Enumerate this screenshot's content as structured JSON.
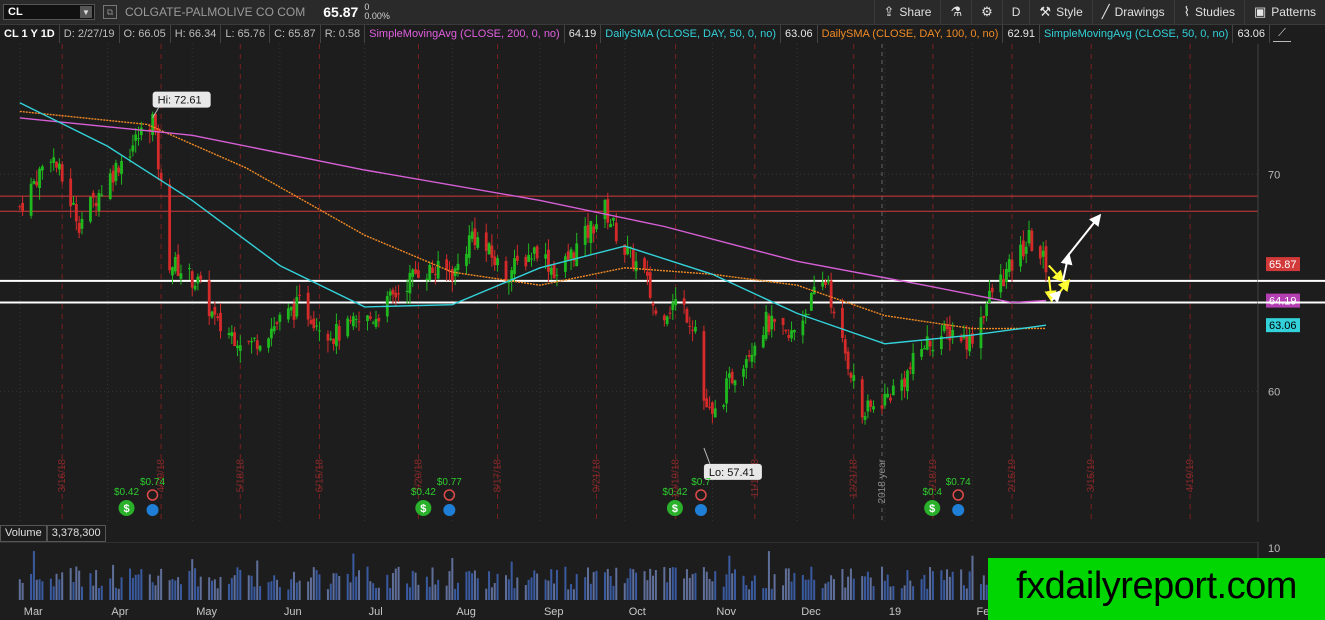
{
  "header": {
    "symbol": "CL",
    "company": "COLGATE-PALMOLIVE CO COM",
    "last": "65.87",
    "change": "0",
    "change_pct": "0.00%"
  },
  "toolbar": {
    "buttons": [
      {
        "id": "share",
        "label": "Share",
        "icon": "share-icon",
        "glyph": "⇪"
      },
      {
        "id": "flask",
        "label": "",
        "icon": "flask-icon",
        "glyph": "⚗"
      },
      {
        "id": "gear",
        "label": "",
        "icon": "gear-icon",
        "glyph": "⚙"
      },
      {
        "id": "period",
        "label": "D",
        "icon": "",
        "glyph": ""
      },
      {
        "id": "style",
        "label": "Style",
        "icon": "style-icon",
        "glyph": "⚒"
      },
      {
        "id": "drawings",
        "label": "Drawings",
        "icon": "drawings-icon",
        "glyph": "╱"
      },
      {
        "id": "studies",
        "label": "Studies",
        "icon": "studies-icon",
        "glyph": "⌇"
      },
      {
        "id": "patterns",
        "label": "Patterns",
        "icon": "patterns-icon",
        "glyph": "▣"
      }
    ]
  },
  "studies_bar": {
    "symbol_period": "CL 1 Y 1D",
    "date": "D: 2/27/19",
    "open": "O: 66.05",
    "high": "H: 66.34",
    "low": "L: 65.76",
    "close": "C: 65.87",
    "range": "R: 0.58",
    "studies": [
      {
        "label": "SimpleMovingAvg (CLOSE, 200, 0, no)",
        "value": "64.19",
        "color": "#e05fe0"
      },
      {
        "label": "DailySMA (CLOSE, DAY, 50, 0, no)",
        "value": "63.06",
        "color": "#33d1d9"
      },
      {
        "label": "DailySMA (CLOSE, DAY, 100, 0, no)",
        "value": "62.91",
        "color": "#f08a24"
      },
      {
        "label": "SimpleMovingAvg (CLOSE, 50, 0, no)",
        "value": "63.06",
        "color": "#33d1d9"
      }
    ]
  },
  "volume": {
    "label": "Volume",
    "value": "3,378,300",
    "axis_tick": "10"
  },
  "watermark": "fxdailyreport.com",
  "chart_data": {
    "type": "candlestick",
    "ylim": [
      54,
      76
    ],
    "y_ticks": [
      60,
      70
    ],
    "x_month_labels": [
      {
        "label": "Mar",
        "date": "2018-03-01"
      },
      {
        "label": "Apr",
        "date": "2018-04-01"
      },
      {
        "label": "May",
        "date": "2018-05-01"
      },
      {
        "label": "Jun",
        "date": "2018-06-01"
      },
      {
        "label": "Jul",
        "date": "2018-07-01"
      },
      {
        "label": "Aug",
        "date": "2018-08-01"
      },
      {
        "label": "Sep",
        "date": "2018-09-01"
      },
      {
        "label": "Oct",
        "date": "2018-10-01"
      },
      {
        "label": "Nov",
        "date": "2018-11-01"
      },
      {
        "label": "Dec",
        "date": "2018-12-01"
      },
      {
        "label": "19",
        "date": "2019-01-01"
      },
      {
        "label": "Feb",
        "date": "2019-02-01"
      }
    ],
    "expiration_lines": [
      {
        "label": "3/16/18",
        "date": "2018-03-16"
      },
      {
        "label": "4/20/18",
        "date": "2018-04-20"
      },
      {
        "label": "5/18/18",
        "date": "2018-05-18"
      },
      {
        "label": "6/15/18",
        "date": "2018-06-15"
      },
      {
        "label": "7/20/18",
        "date": "2018-07-20"
      },
      {
        "label": "8/17/18",
        "date": "2018-08-17"
      },
      {
        "label": "9/21/18",
        "date": "2018-09-21"
      },
      {
        "label": "10/19/18",
        "date": "2018-10-19"
      },
      {
        "label": "11/16/18",
        "date": "2018-11-16"
      },
      {
        "label": "12/21/18",
        "date": "2018-12-21"
      },
      {
        "label": "1/18/19",
        "date": "2019-01-18"
      },
      {
        "label": "2/15/19",
        "date": "2019-02-15"
      },
      {
        "label": "3/15/19",
        "date": "2019-03-15"
      },
      {
        "label": "4/19/19",
        "date": "2019-04-19"
      }
    ],
    "year_marker": {
      "label": "2018 year",
      "date": "2018-12-31"
    },
    "key_prices": [
      {
        "date": "2018-03-01",
        "price": 68.5
      },
      {
        "date": "2018-03-12",
        "price": 71.0
      },
      {
        "date": "2018-03-22",
        "price": 67.8
      },
      {
        "date": "2018-04-05",
        "price": 70.5
      },
      {
        "date": "2018-04-17",
        "price": 72.6
      },
      {
        "date": "2018-04-19",
        "price": 70.5
      },
      {
        "date": "2018-04-23",
        "price": 66.0
      },
      {
        "date": "2018-05-03",
        "price": 65.0
      },
      {
        "date": "2018-05-10",
        "price": 63.0
      },
      {
        "date": "2018-05-22",
        "price": 62.2
      },
      {
        "date": "2018-06-08",
        "price": 64.0
      },
      {
        "date": "2018-06-20",
        "price": 62.6
      },
      {
        "date": "2018-07-05",
        "price": 63.5
      },
      {
        "date": "2018-07-20",
        "price": 65.6
      },
      {
        "date": "2018-08-02",
        "price": 65.5
      },
      {
        "date": "2018-08-08",
        "price": 67.3
      },
      {
        "date": "2018-08-20",
        "price": 65.4
      },
      {
        "date": "2018-08-31",
        "price": 66.6
      },
      {
        "date": "2018-09-07",
        "price": 65.4
      },
      {
        "date": "2018-09-19",
        "price": 67.5
      },
      {
        "date": "2018-09-24",
        "price": 68.4
      },
      {
        "date": "2018-10-01",
        "price": 66.5
      },
      {
        "date": "2018-10-08",
        "price": 65.4
      },
      {
        "date": "2018-10-12",
        "price": 63.5
      },
      {
        "date": "2018-10-20",
        "price": 64.2
      },
      {
        "date": "2018-10-26",
        "price": 63.0
      },
      {
        "date": "2018-10-29",
        "price": 59.6
      },
      {
        "date": "2018-11-01",
        "price": 58.7
      },
      {
        "date": "2018-11-08",
        "price": 60.7
      },
      {
        "date": "2018-11-20",
        "price": 63.2
      },
      {
        "date": "2018-11-28",
        "price": 62.4
      },
      {
        "date": "2018-12-07",
        "price": 64.4
      },
      {
        "date": "2018-12-12",
        "price": 65.2
      },
      {
        "date": "2018-12-14",
        "price": 63.3
      },
      {
        "date": "2018-12-20",
        "price": 61.0
      },
      {
        "date": "2018-12-24",
        "price": 58.9
      },
      {
        "date": "2019-01-02",
        "price": 59.8
      },
      {
        "date": "2019-01-08",
        "price": 60.6
      },
      {
        "date": "2019-01-15",
        "price": 62.2
      },
      {
        "date": "2019-01-25",
        "price": 62.8
      },
      {
        "date": "2019-01-31",
        "price": 62.3
      },
      {
        "date": "2019-02-08",
        "price": 64.6
      },
      {
        "date": "2019-02-14",
        "price": 65.6
      },
      {
        "date": "2019-02-21",
        "price": 67.0
      },
      {
        "date": "2019-02-27",
        "price": 65.87
      }
    ],
    "ma_200": [
      {
        "date": "2018-03-01",
        "price": 72.6
      },
      {
        "date": "2018-05-01",
        "price": 71.8
      },
      {
        "date": "2018-07-01",
        "price": 70.2
      },
      {
        "date": "2018-09-01",
        "price": 68.8
      },
      {
        "date": "2018-10-15",
        "price": 67.6
      },
      {
        "date": "2018-12-01",
        "price": 66.0
      },
      {
        "date": "2019-01-15",
        "price": 64.9
      },
      {
        "date": "2019-02-15",
        "price": 64.1
      },
      {
        "date": "2019-02-27",
        "price": 64.19
      }
    ],
    "ma_50": [
      {
        "date": "2018-03-01",
        "price": 73.3
      },
      {
        "date": "2018-04-01",
        "price": 71.3
      },
      {
        "date": "2018-05-01",
        "price": 68.8
      },
      {
        "date": "2018-06-01",
        "price": 65.8
      },
      {
        "date": "2018-07-01",
        "price": 63.9
      },
      {
        "date": "2018-08-01",
        "price": 64.0
      },
      {
        "date": "2018-09-01",
        "price": 65.7
      },
      {
        "date": "2018-10-01",
        "price": 66.7
      },
      {
        "date": "2018-11-01",
        "price": 65.4
      },
      {
        "date": "2018-12-01",
        "price": 63.6
      },
      {
        "date": "2019-01-01",
        "price": 62.2
      },
      {
        "date": "2019-02-01",
        "price": 62.6
      },
      {
        "date": "2019-02-27",
        "price": 63.06
      }
    ],
    "ma_100": [
      {
        "date": "2018-03-01",
        "price": 72.9
      },
      {
        "date": "2018-04-15",
        "price": 72.3
      },
      {
        "date": "2018-05-20",
        "price": 70.3
      },
      {
        "date": "2018-07-01",
        "price": 67.2
      },
      {
        "date": "2018-08-01",
        "price": 65.5
      },
      {
        "date": "2018-09-01",
        "price": 64.9
      },
      {
        "date": "2018-10-01",
        "price": 65.7
      },
      {
        "date": "2018-11-01",
        "price": 65.4
      },
      {
        "date": "2018-12-01",
        "price": 64.9
      },
      {
        "date": "2019-01-01",
        "price": 63.5
      },
      {
        "date": "2019-02-01",
        "price": 62.9
      },
      {
        "date": "2019-02-27",
        "price": 62.91
      }
    ],
    "horizontal_lines": [
      {
        "price": 69.0,
        "color": "#d23a3a"
      },
      {
        "price": 68.3,
        "color": "#d23a3a"
      },
      {
        "price": 65.1,
        "color": "#ffffff"
      },
      {
        "price": 64.1,
        "color": "#ffffff"
      }
    ],
    "price_labels": [
      {
        "value": "65.87",
        "price": 65.87,
        "bg": "#d23a3a",
        "fg": "#ffffff"
      },
      {
        "value": "64.19",
        "price": 64.19,
        "bg": "#b33fb3",
        "fg": "#ffffff"
      },
      {
        "value": "63.06",
        "price": 63.06,
        "bg": "#33d1d9",
        "fg": "#000000"
      }
    ],
    "callouts": [
      {
        "label": "Hi: 72.61",
        "date": "2018-04-17",
        "price": 72.61,
        "placement": "above"
      },
      {
        "label": "Lo: 57.41",
        "date": "2018-10-29",
        "price": 57.41,
        "placement": "below"
      }
    ],
    "arrows": [
      {
        "from": {
          "date": "2019-02-28",
          "price": 65.8
        },
        "to": {
          "date": "2019-03-05",
          "price": 65.1
        },
        "color": "#ffff33"
      },
      {
        "from": {
          "date": "2019-03-05",
          "price": 65.1
        },
        "to": {
          "date": "2019-03-07",
          "price": 66.3
        },
        "color": "#ffffff"
      },
      {
        "from": {
          "date": "2019-03-07",
          "price": 66.3
        },
        "to": {
          "date": "2019-03-18",
          "price": 68.1
        },
        "color": "#ffffff"
      },
      {
        "from": {
          "date": "2019-02-28",
          "price": 65.3
        },
        "to": {
          "date": "2019-03-01",
          "price": 64.2
        },
        "color": "#ffff33"
      },
      {
        "from": {
          "date": "2019-03-01",
          "price": 64.2
        },
        "to": {
          "date": "2019-03-04",
          "price": 64.6
        },
        "color": "#ffffff"
      },
      {
        "from": {
          "date": "2019-03-04",
          "price": 64.6
        },
        "to": {
          "date": "2019-03-07",
          "price": 65.1
        },
        "color": "#ffff33"
      }
    ],
    "events": [
      {
        "date": "2018-04-12",
        "dividend": "$0.42",
        "estimate": "$0.74"
      },
      {
        "date": "2018-07-26",
        "dividend": "$0.42",
        "estimate": "$0.77"
      },
      {
        "date": "2018-10-23",
        "dividend": "$0.42",
        "estimate": "$0.7"
      },
      {
        "date": "2019-01-22",
        "dividend": "$0.4",
        "estimate": "$0.74"
      }
    ]
  }
}
